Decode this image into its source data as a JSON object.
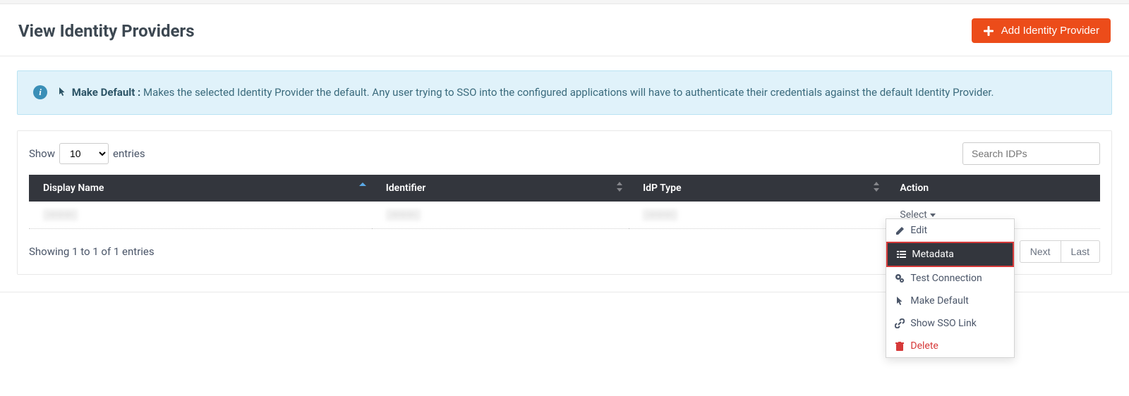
{
  "header": {
    "title": "View Identity Providers",
    "add_label": "Add Identity Provider"
  },
  "info": {
    "heading": "Make Default :",
    "body": "Makes the selected Identity Provider the default. Any user trying to SSO into the configured applications will have to authenticate their credentials against the default Identity Provider."
  },
  "table_controls": {
    "show_label": "Show",
    "entries_label": "entries",
    "page_size": "10",
    "search_placeholder": "Search IDPs"
  },
  "columns": {
    "display_name": "Display Name",
    "identifier": "Identifier",
    "idp_type": "IdP Type",
    "action": "Action"
  },
  "rows": [
    {
      "display_name": "———",
      "identifier": "———",
      "idp_type": "———",
      "action_label": "Select"
    }
  ],
  "dropdown": {
    "edit": "Edit",
    "metadata": "Metadata",
    "test_connection": "Test Connection",
    "make_default": "Make Default",
    "show_sso_link": "Show SSO Link",
    "delete": "Delete"
  },
  "footer": {
    "info": "Showing 1 to 1 of 1 entries",
    "next": "Next",
    "last": "Last"
  }
}
